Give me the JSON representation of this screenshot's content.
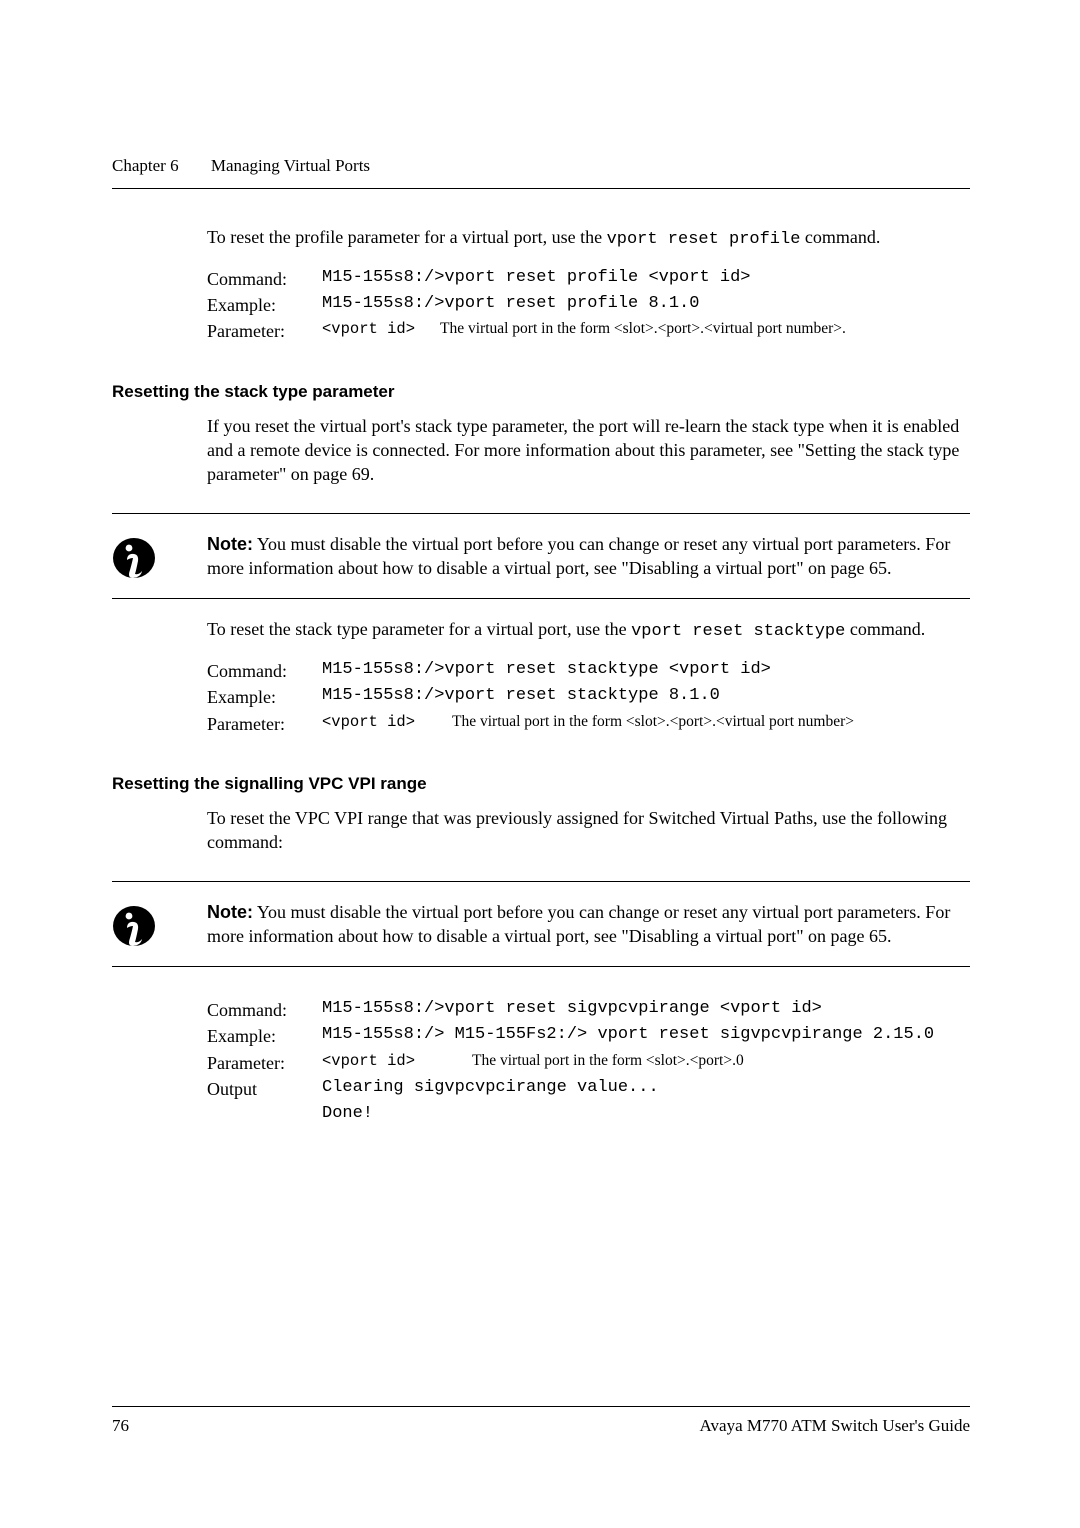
{
  "running_head": {
    "chapter": "Chapter 6",
    "title": "Managing Virtual Ports"
  },
  "intro1_a": "To reset the profile parameter for a virtual port, use the ",
  "intro1_code": "vport reset profile",
  "intro1_b": " command.",
  "labels": {
    "command": "Command:",
    "example": "Example:",
    "parameter": "Parameter:",
    "output": "Output"
  },
  "block1": {
    "command": "M15-155s8:/>vport reset profile <vport id>",
    "example": "M15-155s8:/>vport reset profile 8.1.0",
    "param_key": "<vport id>",
    "param_val": "The virtual port in the form <slot>.<port>.<virtual port number>."
  },
  "heading_stack": "Resetting the stack type parameter",
  "stack_para": "If you reset the virtual port's stack type parameter, the port will re-learn the stack type when it is enabled and a remote device is connected. For more information about this parameter, see \"Setting the stack type parameter\" on page 69.",
  "note_generic_a": "Note:",
  "note_generic_b": "  You must disable the virtual port before you can change or reset any virtual port parameters. For more information about how to disable a virtual port, see \"Disabling a virtual port\" on page 65.",
  "intro2_a": "To reset the stack type parameter for a virtual port, use the ",
  "intro2_code": "vport reset stacktype",
  "intro2_b": " command.",
  "block2": {
    "command": "M15-155s8:/>vport reset stacktype <vport id>",
    "example": "M15-155s8:/>vport reset stacktype 8.1.0",
    "param_key": "<vport id>",
    "param_val": "The virtual port in the form <slot>.<port>.<virtual port number>"
  },
  "heading_sig": "Resetting the signalling VPC VPI range",
  "sig_para": "To reset the VPC VPI range that was previously assigned for Switched Virtual Paths, use the following command:",
  "block3": {
    "command": "M15-155s8:/>vport reset sigvpcvpirange <vport id>",
    "example": "M15-155s8:/> M15-155Fs2:/> vport reset sigvpcvpirange 2.15.0",
    "param_key": "<vport id>",
    "param_val": "The virtual port in the form <slot>.<port>.0",
    "output1": "Clearing sigvpcvpcirange value...",
    "output2": "Done!"
  },
  "footer": {
    "page": "76",
    "title": "Avaya M770 ATM Switch User's Guide"
  }
}
